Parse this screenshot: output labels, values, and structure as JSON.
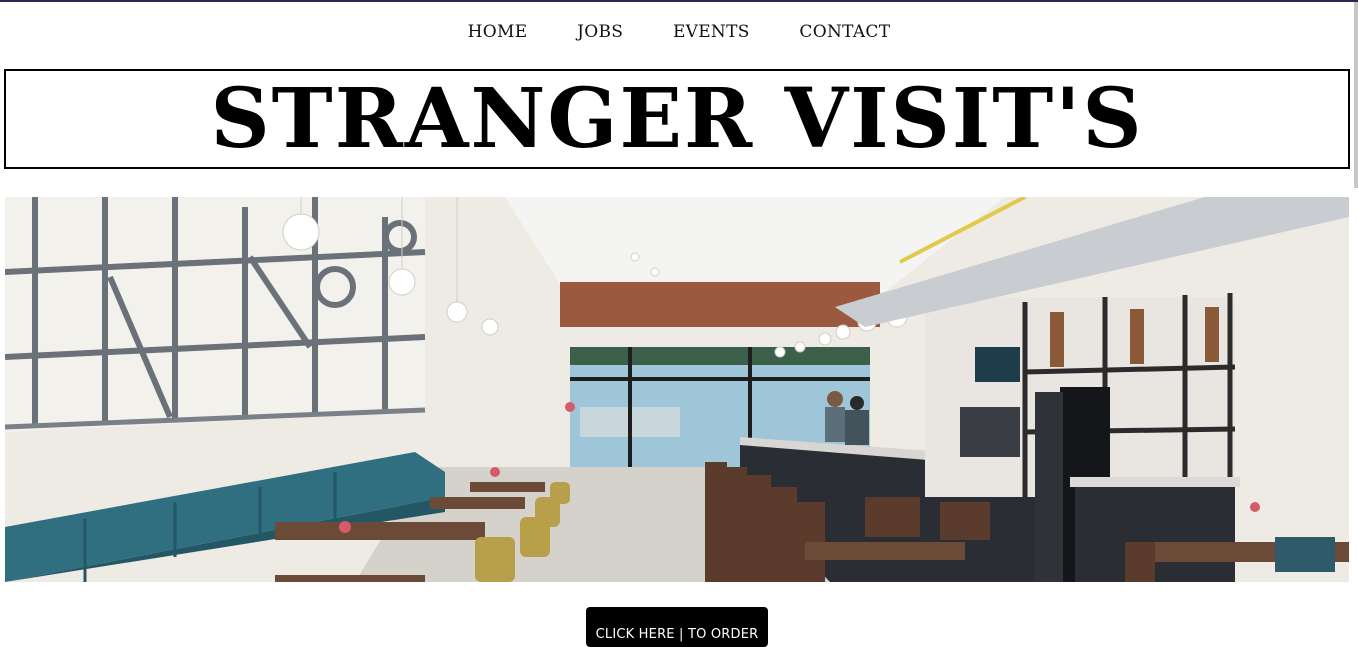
{
  "nav": {
    "items": [
      {
        "label": "HOME"
      },
      {
        "label": "JOBS"
      },
      {
        "label": "EVENTS"
      },
      {
        "label": "CONTACT"
      }
    ]
  },
  "header": {
    "title": "STRANGER VISIT'S"
  },
  "hero": {
    "image": "cafe-interior-photo"
  },
  "cta": {
    "label": "CLICK HERE | TO ORDER"
  },
  "colors": {
    "accent_rule": "#2b2550",
    "button_bg": "#000000",
    "button_text": "#ffffff",
    "wall_teal": "#2f6f80"
  }
}
